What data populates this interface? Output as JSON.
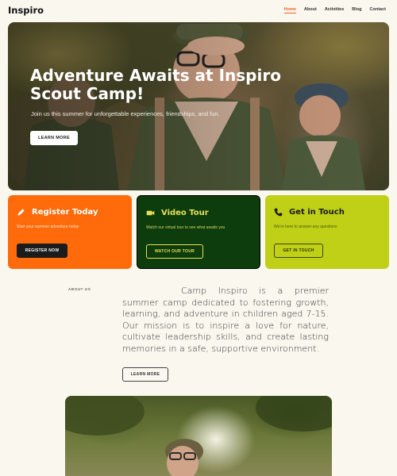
{
  "header": {
    "logo": "Inspiro",
    "nav": [
      "Home",
      "About",
      "Activities",
      "Blog",
      "Contact"
    ],
    "active_nav": "Home"
  },
  "hero": {
    "title": "Adventure Awaits at Inspiro Scout Camp!",
    "subtitle": "Join us this summer for unforgettable experiences, friendships, and fun.",
    "button": "LEARN MORE"
  },
  "cards": [
    {
      "icon": "pencil-icon",
      "title": "Register Today",
      "text": "Start your summer adventure today",
      "button": "REGISTER NOW",
      "bg": "#ff6b0a"
    },
    {
      "icon": "video-camera-icon",
      "title": "Video Tour",
      "text": "Watch our virtual tour to see what awaits you",
      "button": "WATCH OUR TOUR",
      "bg": "#0d3d0c"
    },
    {
      "icon": "phone-icon",
      "title": "Get in Touch",
      "text": "We're here to answer any questions",
      "button": "GET IN TOUCH",
      "bg": "#bfd016"
    }
  ],
  "about": {
    "label": "ABOUT US",
    "text": "Camp Inspiro is a premier summer camp dedicated to fostering growth, learning, and adventure in children aged 7-15. Our mission is to inspire a love for nature, cultivate leadership skills, and create lasting memories in a safe, supportive environment.",
    "button": "LEARN MORE"
  },
  "colors": {
    "accent": "#f2622a",
    "orange": "#ff6b0a",
    "dark_green": "#0d3d0c",
    "lime": "#bfd016",
    "background": "#faf7ee"
  }
}
